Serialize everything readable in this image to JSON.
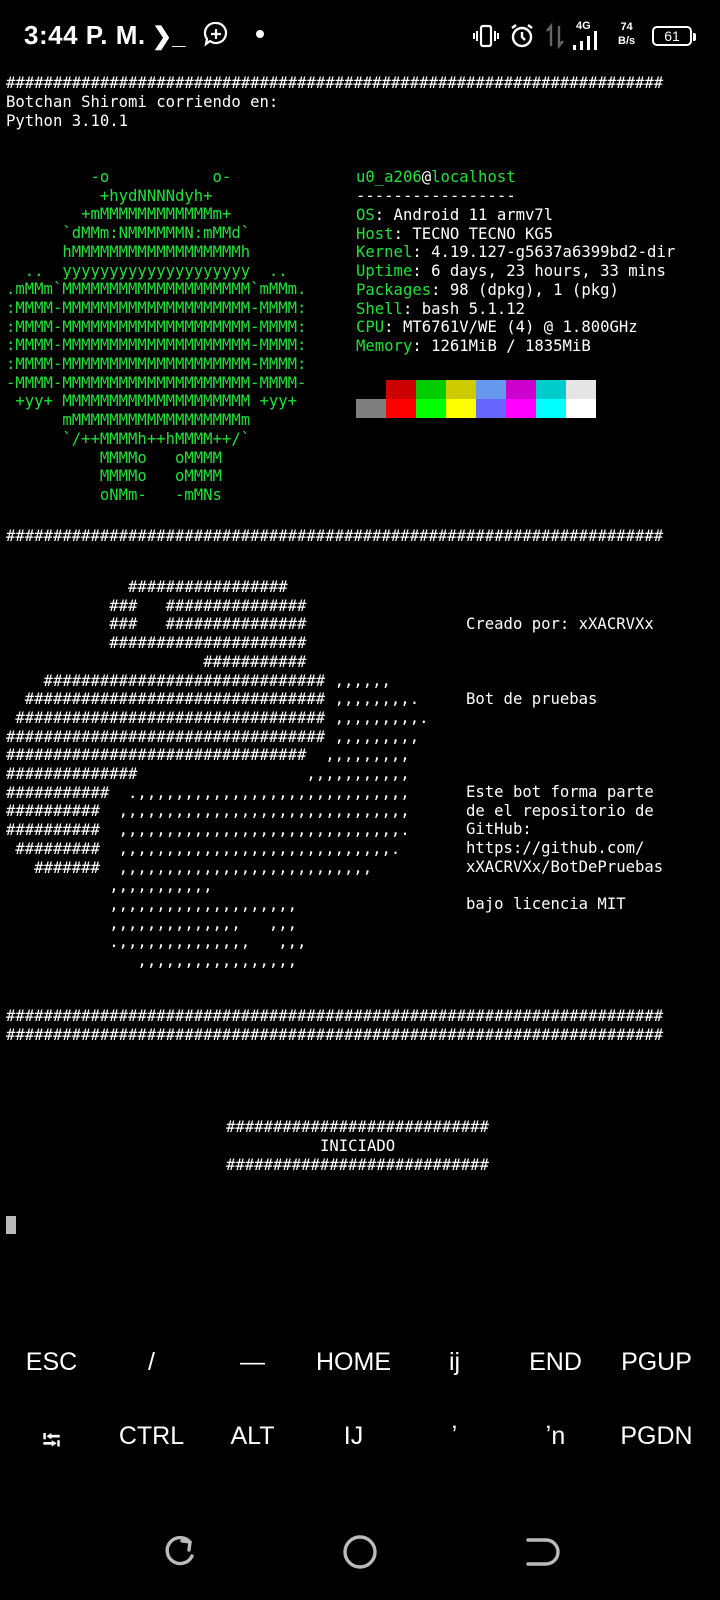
{
  "status_bar": {
    "time": "3:44 P. M.",
    "network_type": "4G",
    "net_speed_value": "74",
    "net_speed_unit": "B/s",
    "battery": "61",
    "icons": [
      "terminal-prompt-icon",
      "chat-plus-icon",
      "dot-icon",
      "vibrate-icon",
      "alarm-icon",
      "data-arrows-icon",
      "signal-icon"
    ]
  },
  "terminal": {
    "top_separator": "######################################################################",
    "header_lines": [
      "Botchan Shiromi corriendo en:",
      "Python 3.10.1"
    ],
    "logo_lines": [
      "         -o           o-",
      "          +hydNNNNdyh+",
      "        +mMMMMMMMMMMMMm+",
      "      `dMMm:NMMMMMMN:mMMd`",
      "      hMMMMMMMMMMMMMMMMMMh",
      "  ..  yyyyyyyyyyyyyyyyyyyy  ..",
      ".mMMm`MMMMMMMMMMMMMMMMMMMM`mMMm.",
      ":MMMM-MMMMMMMMMMMMMMMMMMMM-MMMM:",
      ":MMMM-MMMMMMMMMMMMMMMMMMMM-MMMM:",
      ":MMMM-MMMMMMMMMMMMMMMMMMMM-MMMM:",
      ":MMMM-MMMMMMMMMMMMMMMMMMMM-MMMM:",
      "-MMMM-MMMMMMMMMMMMMMMMMMMM-MMMM-",
      " +yy+ MMMMMMMMMMMMMMMMMMMM +yy+",
      "      mMMMMMMMMMMMMMMMMMMm",
      "      `/++MMMMh++hMMMM++/`",
      "          MMMMo   oMMMM",
      "          MMMMo   oMMMM",
      "          oNMm-   -mMNs"
    ],
    "sysinfo": {
      "user": "u0_a206",
      "at": "@",
      "host": "localhost",
      "rule": "-----------------",
      "fields": [
        {
          "key": "OS",
          "value": ": Android 11 armv7l"
        },
        {
          "key": "Host",
          "value": ": TECNO TECNO KG5"
        },
        {
          "key": "Kernel",
          "value": ": 4.19.127-g5637a6399bd2-dir"
        },
        {
          "key": "Uptime",
          "value": ": 6 days, 23 hours, 33 mins"
        },
        {
          "key": "Packages",
          "value": ": 98 (dpkg), 1 (pkg)"
        },
        {
          "key": "Shell",
          "value": ": bash 5.1.12"
        },
        {
          "key": "CPU",
          "value": ": MT6761V/WE (4) @ 1.800GHz"
        },
        {
          "key": "Memory",
          "value": ": 1261MiB / 1835MiB"
        }
      ],
      "palette_top": [
        "#000000",
        "#cc0000",
        "#00cc00",
        "#cccc00",
        "#6699ee",
        "#cc00cc",
        "#00cccc",
        "#e5e5e5"
      ],
      "palette_bottom": [
        "#7f7f7f",
        "#ff0000",
        "#00ff00",
        "#ffff00",
        "#6666ff",
        "#ff00ff",
        "#00ffff",
        "#ffffff"
      ]
    },
    "mid_separator": "######################################################################",
    "art_lines": [
      "             #################",
      "           ###   ###############",
      "           ###   ###############",
      "           #####################",
      "                     ###########",
      "    ############################## ,,,,,,",
      "  ################################ ,,,,,,,,.",
      " ################################# ,,,,,,,,,.",
      "################################## ,,,,,,,,,",
      "################################  ,,,,,,,,,",
      "##############                  ,,,,,,,,,,,",
      "###########  .,,,,,,,,,,,,,,,,,,,,,,,,,,,,,",
      "##########  ,,,,,,,,,,,,,,,,,,,,,,,,,,,,,,,",
      "##########  ,,,,,,,,,,,,,,,,,,,,,,,,,,,,,,.",
      " #########  ,,,,,,,,,,,,,,,,,,,,,,,,,,,,,.",
      "   #######  ,,,,,,,,,,,,,,,,,,,,,,,,,,,",
      "           ,,,,,,,,,,,",
      "           ,,,,,,,,,,,,,,,,,,,,",
      "           ,,,,,,,,,,,,,,   ,,,",
      "           .,,,,,,,,,,,,,,   ,,,",
      "              ,,,,,,,,,,,,,,,,,"
    ],
    "info_text": {
      "created_by": "Creado por: xXACRVXx",
      "bot_name": "Bot de pruebas",
      "description_lines": [
        "Este bot forma parte",
        "de el repositorio de",
        "GitHub:",
        "https://github.com/",
        "xXACRVXx/BotDePruebas",
        "",
        "bajo licencia MIT"
      ]
    },
    "bottom_separator_1": "######################################################################",
    "bottom_separator_2": "######################################################################",
    "banner_top": "############################",
    "banner_text": "INICIADO",
    "banner_bottom": "############################"
  },
  "extra_keys": {
    "row1": [
      "ESC",
      "/",
      "—",
      "HOME",
      "ij",
      "END",
      "PGUP"
    ],
    "row2": [
      "⭾",
      "CTRL",
      "ALT",
      "IJ",
      "ʼ",
      "ʼn",
      "PGDN"
    ]
  },
  "nav_bar": {
    "icons": [
      "recent-apps-icon",
      "home-icon",
      "back-icon"
    ]
  }
}
